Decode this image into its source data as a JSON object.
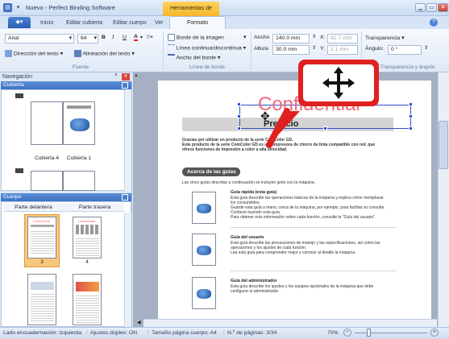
{
  "app": {
    "title": "Nuevo - Perfect Binding Software",
    "contextual_tab_group": "Herramientas de dibujo"
  },
  "tabs": [
    "Inicio",
    "Editar cubierta",
    "Editar cuerpo",
    "Ver",
    "Formato"
  ],
  "active_tab": "Formato",
  "ribbon": {
    "font_name": "Arial",
    "font_size": "64",
    "bold": "B",
    "italic": "I",
    "underline": "U",
    "text_direction": "Dirección del texto",
    "text_align": "Alineación del texto",
    "group_font": "Fuente",
    "border_image": "Borde de la imagen",
    "line_style": "Línea continua/discontinua",
    "border_width": "Ancho del borde",
    "group_line": "Línea de borde",
    "width_label": "Ancho",
    "width_value": "140.0 mm",
    "height_label": "Altura",
    "height_value": "30.0 mm",
    "x_label": "X:",
    "x_value": "62.7 mm",
    "y_label": "Y:",
    "y_value": "2.1 mm",
    "group_size": "Tamaño",
    "transparency": "Transparencia",
    "angle_label": "Ángulo:",
    "angle_value": "0 °",
    "group_transp": "Transparencia y ángulo"
  },
  "nav": {
    "title": "Navegación",
    "pin": "📌",
    "cover_section": "Cubierta",
    "cover_labels": [
      "Cubierta 4",
      "Cubierta 1"
    ],
    "body_section": "Cuerpo",
    "col_front": "Parte delantera",
    "col_back": "Parte trasera",
    "page_numbers": [
      "3",
      "4"
    ]
  },
  "document": {
    "watermark": "Confidential",
    "heading": "Prefacio",
    "intro_line1": "Gracias por utilizar un producto de la serie ComColor GD.",
    "intro_line2": "Este producto de la serie ComColor GD es una impresora de chorro de tinta compatible con red, que",
    "intro_line3": "ofrece funciones de impresión a color a alta velocidad.",
    "section_pill": "Acerca de las guías",
    "section_intro": "Las cinco guías descritas a continuación se incluyen junto con la máquina.",
    "guides": [
      {
        "title": "Guía rápida (esta guía)",
        "lines": [
          "Esta guía describe las operaciones básicas de la máquina y explica cómo reemplazar",
          "los consumibles.",
          "Guarde esta guía a mano, cerca de la máquina, por ejemplo, para facilitar su consulta.",
          "Contiene leyendo esta guía.",
          "Para obtener más información sobre cada función, consulte la \"Guía del usuario\"."
        ]
      },
      {
        "title": "Guía del usuario",
        "lines": [
          "Esta guía describe las precauciones de manejo y las especificaciones, así como las",
          "operaciones y los ajustes de cada función.",
          "Lea esta guía para comprender mejor y conocer al detalle la máquina."
        ]
      },
      {
        "title": "Guía del administrador",
        "lines": [
          "Esta guía describe los ajustes y los equipos opcionales de la máquina que debe",
          "configurar el administrador."
        ]
      }
    ]
  },
  "status": {
    "binding": "Lado encuadernación: Izquierda",
    "duplex": "Ajustes dúplex: ON",
    "page_size": "Tamaño página cuerpo: A4",
    "page_count": "N.º de páginas: 3/34",
    "zoom": "70%"
  },
  "colors": {
    "accent_orange": "#f6b62a",
    "selection_red": "#e02020",
    "watermark_red": "#f06a78",
    "nav_header_blue": "#3c72c4"
  }
}
